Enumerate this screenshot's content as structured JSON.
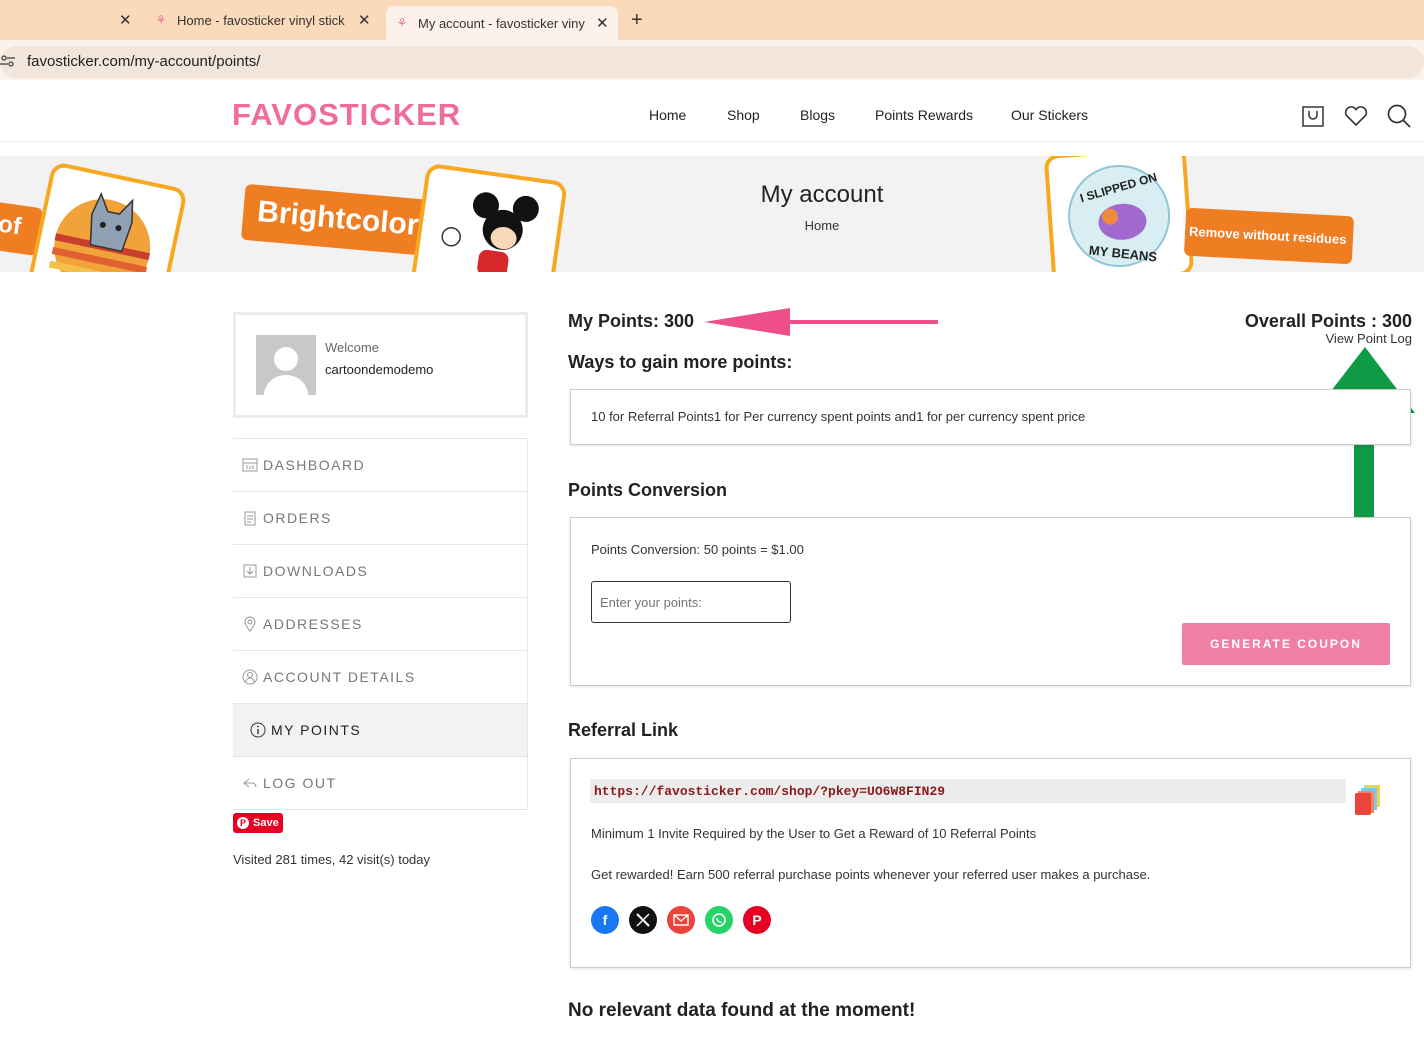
{
  "browser": {
    "tabs": [
      {
        "title": "Home - favosticker vinyl stick",
        "active": false
      },
      {
        "title": "My account - favosticker viny",
        "active": true
      }
    ],
    "url": "favosticker.com/my-account/points/"
  },
  "header": {
    "logo": "FAVOSTICKER",
    "nav": [
      "Home",
      "Shop",
      "Blogs",
      "Points Rewards",
      "Our Stickers"
    ],
    "icons": [
      "cart-icon",
      "heart-icon",
      "search-icon"
    ]
  },
  "banner": {
    "title": "My account",
    "breadcrumb": "Home",
    "tag_left_fragment": "of",
    "tag_brightcolor": "Brightcolor",
    "sticker_text": "I SLIPPED ON MY BEANS",
    "tag_remove": "Remove without residues"
  },
  "sidebar": {
    "welcome": "Welcome",
    "username": "cartoondemodemo",
    "items": [
      {
        "label": "DASHBOARD",
        "icon": "dashboard-icon"
      },
      {
        "label": "ORDERS",
        "icon": "orders-icon"
      },
      {
        "label": "DOWNLOADS",
        "icon": "download-icon"
      },
      {
        "label": "ADDRESSES",
        "icon": "location-icon"
      },
      {
        "label": "ACCOUNT DETAILS",
        "icon": "user-icon"
      },
      {
        "label": "MY POINTS",
        "icon": "info-icon",
        "active": true
      },
      {
        "label": "LOG OUT",
        "icon": "logout-icon"
      }
    ],
    "pinterest_save": "Save",
    "visited": "Visited 281 times, 42 visit(s) today"
  },
  "main": {
    "my_points": "My Points: 300",
    "overall_points": "Overall Points : 300",
    "view_point_log": "View Point Log",
    "ways_heading": "Ways to gain more points:",
    "ways_text": "10 for Referral Points1 for Per currency spent points and1 for per currency spent price",
    "conversion_heading": "Points Conversion",
    "conversion_text": "Points Conversion: 50 points = $1.00",
    "points_placeholder": "Enter your points:",
    "generate_button": "GENERATE COUPON",
    "referral_heading": "Referral Link",
    "referral_url": "https://favosticker.com/shop/?pkey=UO6W8FIN29",
    "referral_min": "Minimum 1 Invite Required by the User to Get a Reward of 10 Referral Points",
    "referral_reward": "Get rewarded! Earn 500 referral purchase points whenever your referred user makes a purchase.",
    "share_icons": [
      "facebook-icon",
      "x-twitter-icon",
      "email-icon",
      "whatsapp-icon",
      "pinterest-icon"
    ],
    "no_data": "No relevant data found at the moment!"
  },
  "annotations": {
    "pink_arrow_color": "#ee4e8a",
    "green_arrow_color": "#0f9a45"
  },
  "colors": {
    "brand_pink": "#ef6d97",
    "button_pink": "#ef7fa5",
    "sticker_orange": "#ef7d22"
  }
}
